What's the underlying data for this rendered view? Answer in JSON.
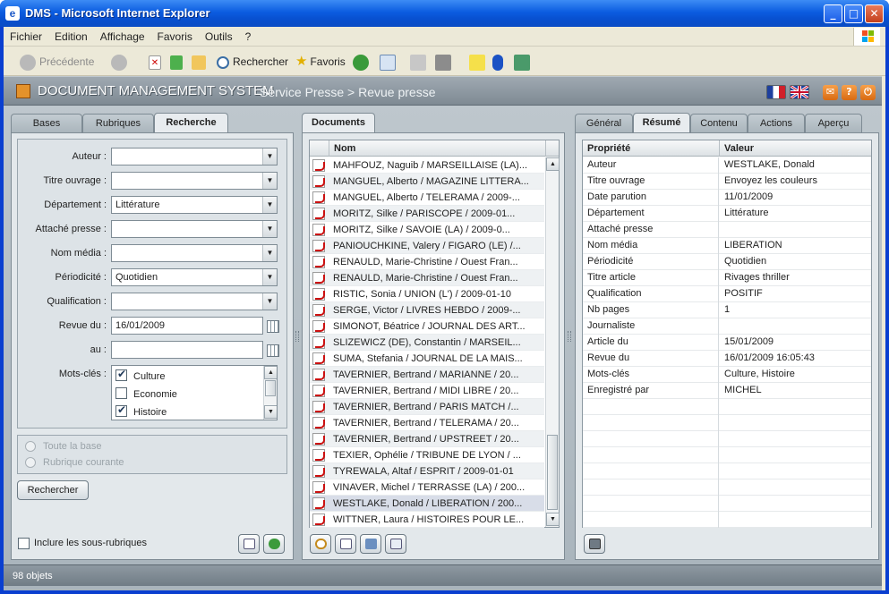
{
  "window": {
    "title": "DMS - Microsoft Internet Explorer"
  },
  "menu": [
    "Fichier",
    "Edition",
    "Affichage",
    "Favoris",
    "Outils",
    "?"
  ],
  "toolbar": {
    "back": "Précédente",
    "search": "Rechercher",
    "favorites": "Favoris"
  },
  "app": {
    "title": "DOCUMENT MANAGEMENT SYSTEM",
    "breadcrumb": "Service Presse > Revue presse",
    "accent": "#e4922b"
  },
  "left": {
    "tabs": [
      "Bases",
      "Rubriques",
      "Recherche"
    ],
    "active_tab": "Recherche",
    "fields": {
      "auteur": {
        "label": "Auteur :",
        "value": ""
      },
      "titre_ouvrage": {
        "label": "Titre ouvrage :",
        "value": ""
      },
      "departement": {
        "label": "Département :",
        "value": "Littérature"
      },
      "attache_presse": {
        "label": "Attaché presse :",
        "value": ""
      },
      "nom_media": {
        "label": "Nom média :",
        "value": ""
      },
      "periodicite": {
        "label": "Périodicité :",
        "value": "Quotidien"
      },
      "qualification": {
        "label": "Qualification :",
        "value": ""
      },
      "revue_du": {
        "label": "Revue du :",
        "value": "16/01/2009"
      },
      "au": {
        "label": "au :",
        "value": ""
      },
      "mots_cles": {
        "label": "Mots-clés :",
        "items": [
          {
            "label": "Culture",
            "checked": true
          },
          {
            "label": "Economie",
            "checked": false
          },
          {
            "label": "Histoire",
            "checked": true
          }
        ]
      }
    },
    "scope": {
      "all": "Toute la base",
      "current": "Rubrique courante"
    },
    "search_button": "Rechercher",
    "include_sub": "Inclure les sous-rubriques"
  },
  "documents": {
    "tab": "Documents",
    "column": "Nom",
    "rows": [
      "MAHFOUZ, Naguib / MARSEILLAISE (LA)...",
      "MANGUEL, Alberto / MAGAZINE LITTERA...",
      "MANGUEL, Alberto / TELERAMA / 2009-...",
      "MORITZ, Silke / PARISCOPE / 2009-01...",
      "MORITZ, Silke / SAVOIE (LA) / 2009-0...",
      "PANIOUCHKINE, Valery / FIGARO (LE) /...",
      "RENAULD, Marie-Christine / Ouest Fran...",
      "RENAULD, Marie-Christine / Ouest Fran...",
      "RISTIC, Sonia / UNION (L') / 2009-01-10",
      "SERGE, Victor / LIVRES HEBDO / 2009-...",
      "SIMONOT, Béatrice / JOURNAL DES ART...",
      "SLIZEWICZ (DE), Constantin / MARSEIL...",
      "SUMA, Stefania / JOURNAL DE LA MAIS...",
      "TAVERNIER,  Bertrand / MARIANNE / 20...",
      "TAVERNIER,  Bertrand / MIDI LIBRE / 20...",
      "TAVERNIER,  Bertrand / PARIS MATCH /...",
      "TAVERNIER,  Bertrand / TELERAMA / 20...",
      "TAVERNIER,  Bertrand / UPSTREET / 20...",
      "TEXIER, Ophélie / TRIBUNE DE LYON / ...",
      "TYREWALA, Altaf / ESPRIT / 2009-01-01",
      "VINAVER, Michel / TERRASSE (LA) / 200...",
      "WESTLAKE, Donald / LIBERATION / 200...",
      "WITTNER, Laura / HISTOIRES POUR LE..."
    ],
    "selected_index": 21
  },
  "right": {
    "tabs": [
      "Général",
      "Résumé",
      "Contenu",
      "Actions",
      "Aperçu"
    ],
    "active_tab": "Résumé",
    "columns": [
      "Propriété",
      "Valeur"
    ],
    "rows": [
      [
        "Auteur",
        "WESTLAKE, Donald"
      ],
      [
        "Titre ouvrage",
        "Envoyez les couleurs"
      ],
      [
        "Date parution",
        "11/01/2009"
      ],
      [
        "Département",
        "Littérature"
      ],
      [
        "Attaché presse",
        ""
      ],
      [
        "Nom média",
        "LIBERATION"
      ],
      [
        "Périodicité",
        "Quotidien"
      ],
      [
        "Titre article",
        "Rivages thriller"
      ],
      [
        "Qualification",
        "POSITIF"
      ],
      [
        "Nb pages",
        "1"
      ],
      [
        "Journaliste",
        ""
      ],
      [
        "Article du",
        "15/01/2009"
      ],
      [
        "Revue du",
        "16/01/2009 16:05:43"
      ],
      [
        "Mots-clés",
        "Culture, Histoire"
      ],
      [
        "Enregistré par",
        "MICHEL"
      ],
      [
        "",
        ""
      ],
      [
        "",
        ""
      ],
      [
        "",
        ""
      ],
      [
        "",
        ""
      ],
      [
        "",
        ""
      ],
      [
        "",
        ""
      ],
      [
        "",
        ""
      ],
      [
        "",
        ""
      ]
    ]
  },
  "status": "98 objets"
}
